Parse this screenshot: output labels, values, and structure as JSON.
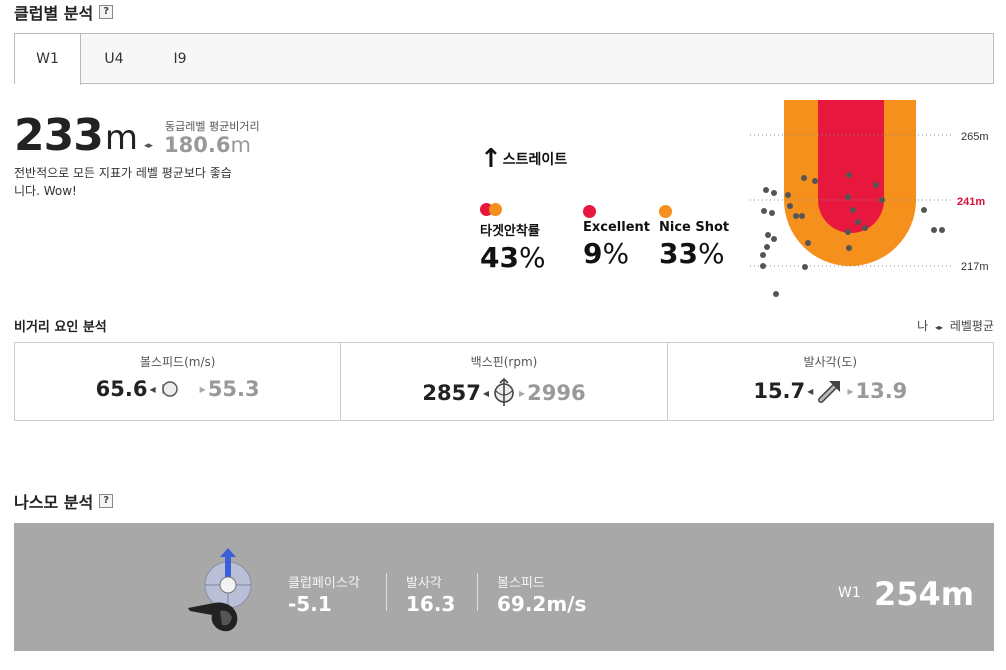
{
  "club_analysis": {
    "title": "클럽별 분석",
    "help": "?",
    "tabs": [
      {
        "label": "W1",
        "active": true
      },
      {
        "label": "U4",
        "active": false
      },
      {
        "label": "I9",
        "active": false
      }
    ]
  },
  "summary": {
    "distance": "233",
    "unit": "m",
    "avg_label": "동급레벨 평균비거리",
    "avg_value": "180.6",
    "avg_unit": "m",
    "description": "전반적으로 모든 지표가 레벨 평균보다 좋습니다. Wow!"
  },
  "direction": {
    "arrow": "↑",
    "label": "스트레이트"
  },
  "stats": [
    {
      "label": "타겟안착률",
      "value": "43",
      "unit": "%",
      "colors": [
        "#e8173d",
        "#f5901c"
      ]
    },
    {
      "label": "Excellent",
      "value": "9",
      "unit": "%",
      "colors": [
        "#e8173d"
      ]
    },
    {
      "label": "Nice Shot",
      "value": "33",
      "unit": "%",
      "colors": [
        "#f5901c"
      ]
    }
  ],
  "diagram": {
    "distances": [
      "265m",
      "241m",
      "217m"
    ],
    "highlight": "241m",
    "colors": {
      "inner": "#e8173d",
      "outer": "#f5901c",
      "dot": "#555555",
      "highlight": "#d8113a"
    }
  },
  "factor": {
    "title": "비거리 요인 분석",
    "legend_me": "나",
    "legend_level": "레벨평균",
    "items": [
      {
        "label": "볼스피드(m/s)",
        "mine": "65.6",
        "level": "55.3",
        "icon": "golf-ball-icon"
      },
      {
        "label": "백스핀(rpm)",
        "mine": "2857",
        "level": "2996",
        "icon": "backspin-icon"
      },
      {
        "label": "발사각(도)",
        "mine": "15.7",
        "level": "13.9",
        "icon": "launch-angle-icon"
      }
    ]
  },
  "nasmo": {
    "title": "나스모 분석",
    "help": "?",
    "items": [
      {
        "label": "클럽페이스각",
        "value": "-5.1"
      },
      {
        "label": "발사각",
        "value": "16.3"
      },
      {
        "label": "볼스피드",
        "value": "69.2m/s"
      }
    ],
    "club": "W1",
    "distance": "254m"
  }
}
